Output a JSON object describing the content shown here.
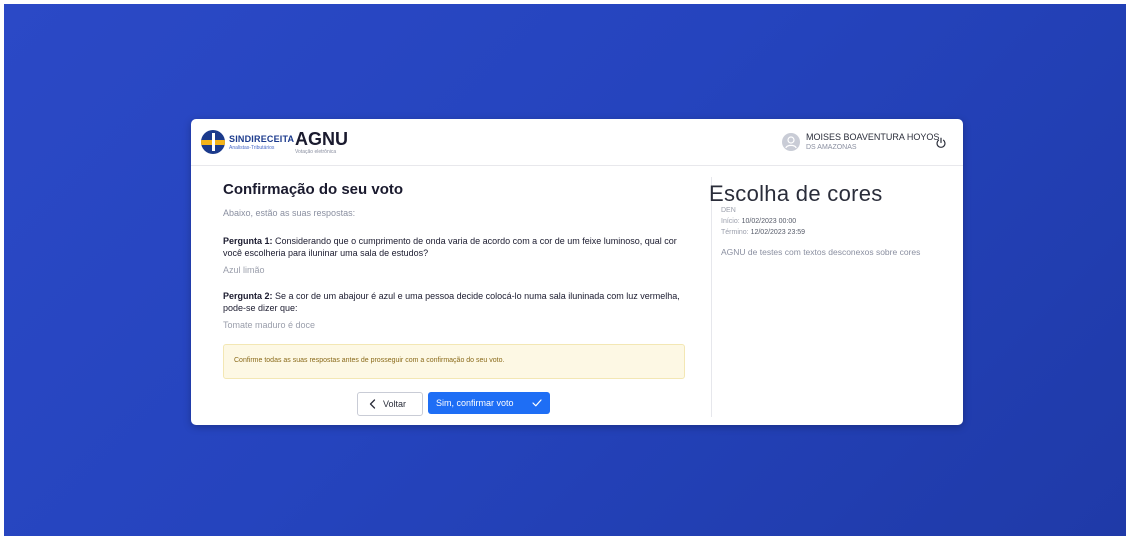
{
  "brand": {
    "name": "SINDIRECEITA",
    "subtitle": "Analistas-Tributários",
    "app_name": "AGNU",
    "app_subtitle": "Votação eletrônica"
  },
  "user": {
    "name": "MOISES BOAVENTURA HOYOS",
    "org": "DS AMAZONAS"
  },
  "confirmation": {
    "title": "Confirmação do seu voto",
    "intro": "Abaixo, estão as suas respostas:",
    "questions": [
      {
        "label": "Pergunta 1:",
        "text": "Considerando que o cumprimento de onda varia de acordo com a cor de um feixe luminoso, qual cor você escolheria para iluninar uma sala de estudos?",
        "answer": "Azul limão"
      },
      {
        "label": "Pergunta 2:",
        "text": "Se a cor de um abajour é azul e uma pessoa decide colocá-lo numa sala iluninada com luz vermelha, pode-se dizer que:",
        "answer": "Tomate maduro é doce"
      }
    ],
    "alert": "Confirme todas as suas respostas antes de prosseguir com a confirmação do seu voto.",
    "back_label": "Voltar",
    "confirm_label": "Sim, confirmar voto"
  },
  "election": {
    "title": "Escolha de cores",
    "code": "DEN",
    "start_label": "Início:",
    "start_value": "10/02/2023 00:00",
    "end_label": "Término:",
    "end_value": "12/02/2023 23:59",
    "description": "AGNU de testes com textos desconexos sobre cores"
  },
  "icons": {
    "user": "user-avatar-icon",
    "power": "power-icon",
    "back": "chevron-left-icon",
    "confirm": "check-icon"
  },
  "colors": {
    "background": "#2544be",
    "primary_button": "#1e6ef5",
    "alert_background": "#fdf8e4"
  }
}
